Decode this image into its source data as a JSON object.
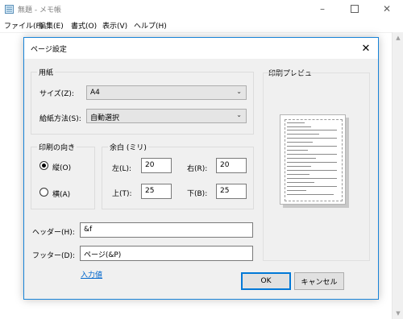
{
  "notepad": {
    "title": "無題 - メモ帳",
    "menu": [
      "ファイル(F)",
      "編集(E)",
      "書式(O)",
      "表示(V)",
      "ヘルプ(H)"
    ]
  },
  "dialog": {
    "title": "ページ設定",
    "paper": {
      "group_label": "用紙",
      "size_label": "サイズ(Z):",
      "size_value": "A4",
      "source_label": "給紙方法(S):",
      "source_value": "自動選択"
    },
    "orientation": {
      "group_label": "印刷の向き",
      "portrait_label": "縦(O)",
      "landscape_label": "横(A)",
      "selected": "portrait"
    },
    "margins": {
      "group_label": "余白 (ミリ)",
      "left_label": "左(L):",
      "left_value": "20",
      "right_label": "右(R):",
      "right_value": "20",
      "top_label": "上(T):",
      "top_value": "25",
      "bottom_label": "下(B):",
      "bottom_value": "25"
    },
    "header_label": "ヘッダー(H):",
    "header_value": "&f",
    "footer_label": "フッター(D):",
    "footer_value": "ページ(&P)",
    "input_link": "入力値",
    "preview_label": "印刷プレビュー",
    "ok_label": "OK",
    "cancel_label": "キャンセル"
  },
  "colors": {
    "accent": "#0078d7",
    "dialog_border": "#1883d7",
    "link": "#0066cc",
    "dialog_bg": "#f0f0f0"
  }
}
